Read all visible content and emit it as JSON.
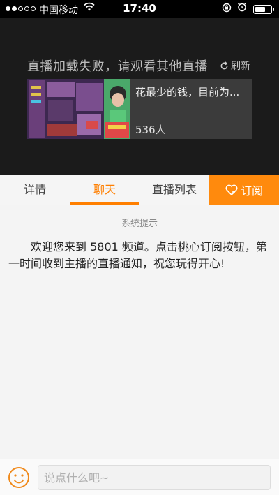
{
  "status_bar": {
    "carrier": "中国移动",
    "time": "17:40",
    "battery_level": 0.7
  },
  "player": {
    "error_message": "直播加载失败，请观看其他直播",
    "refresh_label": "刷新",
    "recommendation": {
      "title": "花最少的钱，目前为...",
      "viewers": "536人"
    }
  },
  "tabs": {
    "items": [
      "详情",
      "聊天",
      "直播列表"
    ],
    "active_index": 1,
    "subscribe_label": "订阅"
  },
  "chat": {
    "system_label": "系统提示",
    "system_message": "欢迎您来到 5801 频道。点击桃心订阅按钮，第一时间收到主播的直播通知，祝您玩得开心!"
  },
  "input": {
    "placeholder": "说点什么吧~"
  },
  "colors": {
    "accent": "#ff7f00",
    "player_bg": "#1b1b1b"
  }
}
